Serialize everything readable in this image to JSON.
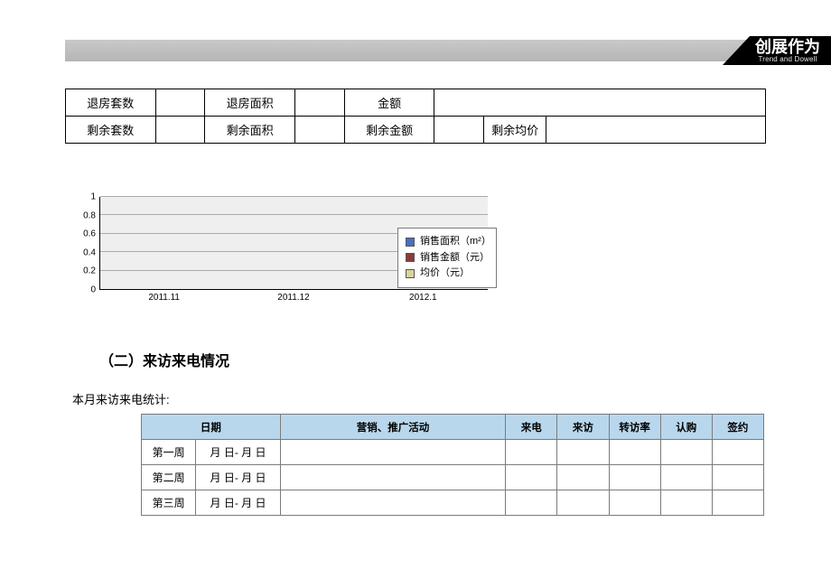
{
  "header": {
    "brand_cn": "创展作为",
    "brand_en": "Trend and Dowell"
  },
  "top_table": {
    "rows": [
      {
        "c1": "退房套数",
        "v1": "",
        "c2": "退房面积",
        "v2": "",
        "c3": "金额",
        "v3": ""
      },
      {
        "c1": "剩余套数",
        "v1": "",
        "c2": "剩余面积",
        "v2": "",
        "c3": "剩余金额",
        "v3": "",
        "c4": "剩余均价",
        "v4": ""
      }
    ]
  },
  "chart_data": {
    "type": "bar",
    "categories": [
      "2011.11",
      "2011.12",
      "2012.1"
    ],
    "series": [
      {
        "name": "销售面积（m²）",
        "color": "#4a70c0",
        "values": [
          0,
          0,
          0
        ]
      },
      {
        "name": "销售金额（元）",
        "color": "#8e3a3a",
        "values": [
          0,
          0,
          0
        ]
      },
      {
        "name": "均价（元）",
        "color": "#d8d49a",
        "values": [
          0,
          0,
          0
        ]
      }
    ],
    "ylim": [
      0,
      1
    ],
    "yticks": [
      "0",
      "0.2",
      "0.4",
      "0.6",
      "0.8",
      "1"
    ]
  },
  "section": {
    "heading": "（二）来访来电情况",
    "subtitle": "本月来访来电统计:"
  },
  "stats_table": {
    "headers": {
      "week": "",
      "range": "日期",
      "activity": "营销、推广活动",
      "call": "来电",
      "visit": "来访",
      "rate": "转访率",
      "intent": "认购",
      "sign": "签约"
    },
    "rows": [
      {
        "week": "第一周",
        "range": "月 日- 月 日",
        "activity": "",
        "call": "",
        "visit": "",
        "rate": "",
        "intent": "",
        "sign": ""
      },
      {
        "week": "第二周",
        "range": "月 日- 月 日",
        "activity": "",
        "call": "",
        "visit": "",
        "rate": "",
        "intent": "",
        "sign": ""
      },
      {
        "week": "第三周",
        "range": "月 日- 月 日",
        "activity": "",
        "call": "",
        "visit": "",
        "rate": "",
        "intent": "",
        "sign": ""
      }
    ]
  }
}
